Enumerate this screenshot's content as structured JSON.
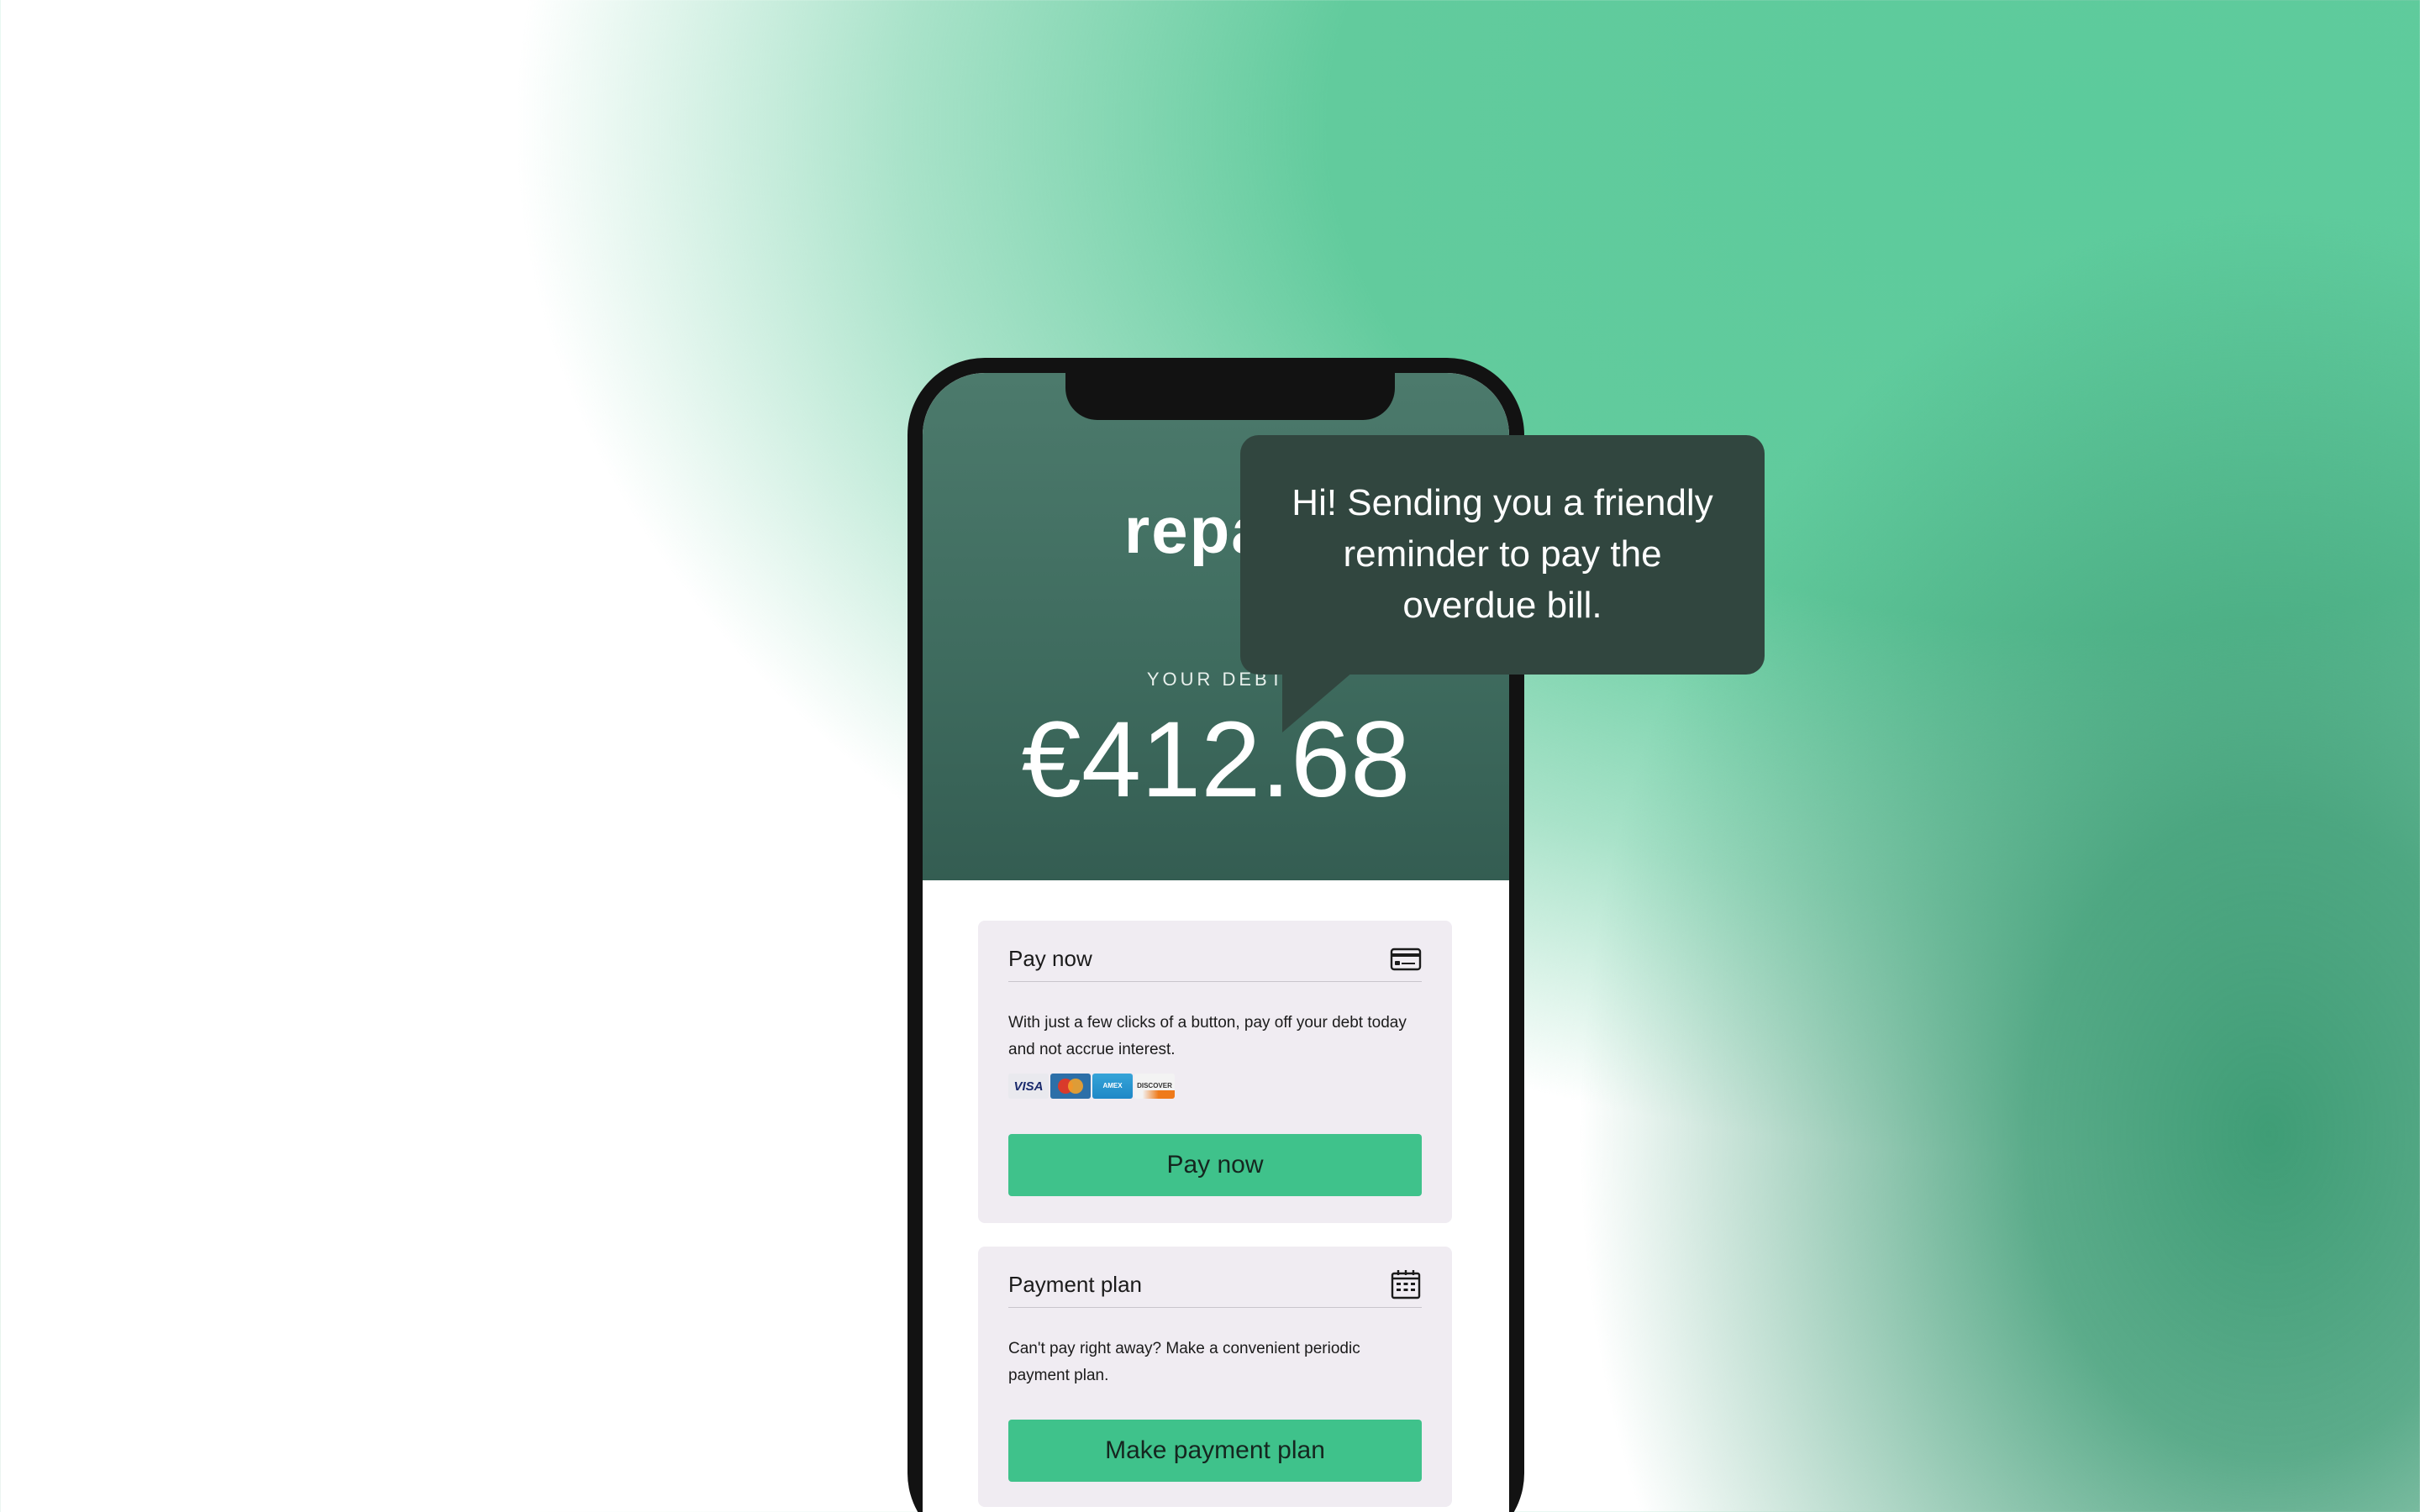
{
  "app": {
    "brand": "repay"
  },
  "debt": {
    "label": "YOUR DEBT",
    "amount": "€412.68"
  },
  "pay_now_card": {
    "title": "Pay now",
    "icon": "credit-card-icon",
    "description": "With just a few clicks of a button, pay off your debt today and not accrue interest.",
    "payment_logos": [
      "VISA",
      "MasterCard",
      "American Express",
      "DISCOVER"
    ],
    "button_label": "Pay now"
  },
  "payment_plan_card": {
    "title": "Payment plan",
    "icon": "calendar-icon",
    "description": "Can't pay right away? Make a convenient periodic payment plan.",
    "button_label": "Make payment plan"
  },
  "reminder_bubble": {
    "text": "Hi! Sending you a friendly reminder to pay the overdue bill."
  },
  "colors": {
    "accent_green": "#3fc28b",
    "hero_dark_green": "#3f6c5f",
    "bubble_bg": "#31463f",
    "card_bg": "#f0ecf2"
  }
}
